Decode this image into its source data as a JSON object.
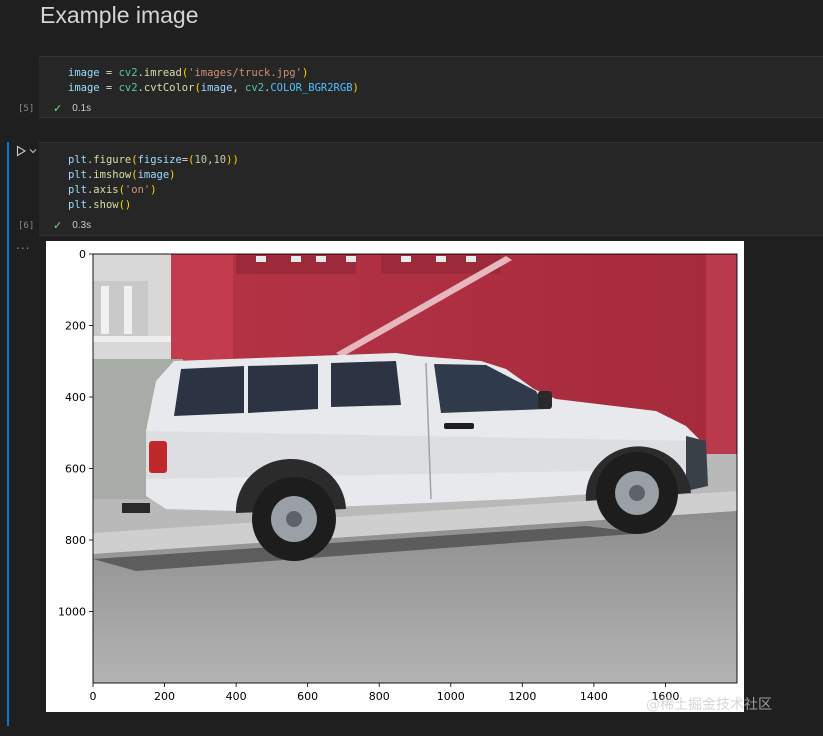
{
  "notebook": {
    "heading": "Example image",
    "cells": [
      {
        "exec_count": "[5]",
        "status_time": "0.1s",
        "lines": [
          [
            [
              "var",
              "image"
            ],
            [
              "plain",
              " = "
            ],
            [
              "mod",
              "cv2"
            ],
            [
              "plain",
              "."
            ],
            [
              "fn",
              "imread"
            ],
            [
              "paren",
              "("
            ],
            [
              "str",
              "'images/truck.jpg'"
            ],
            [
              "paren",
              ")"
            ]
          ],
          [
            [
              "var",
              "image"
            ],
            [
              "plain",
              " = "
            ],
            [
              "mod",
              "cv2"
            ],
            [
              "plain",
              "."
            ],
            [
              "fn",
              "cvtColor"
            ],
            [
              "paren",
              "("
            ],
            [
              "var",
              "image"
            ],
            [
              "plain",
              ", "
            ],
            [
              "mod",
              "cv2"
            ],
            [
              "plain",
              "."
            ],
            [
              "const",
              "COLOR_BGR2RGB"
            ],
            [
              "paren",
              ")"
            ]
          ]
        ]
      },
      {
        "exec_count": "[6]",
        "status_time": "0.3s",
        "lines": [
          [
            [
              "var",
              "plt"
            ],
            [
              "plain",
              "."
            ],
            [
              "fn",
              "figure"
            ],
            [
              "paren",
              "("
            ],
            [
              "var",
              "figsize"
            ],
            [
              "plain",
              "="
            ],
            [
              "paren",
              "("
            ],
            [
              "num",
              "10"
            ],
            [
              "plain",
              ","
            ],
            [
              "num",
              "10"
            ],
            [
              "paren",
              "))"
            ]
          ],
          [
            [
              "var",
              "plt"
            ],
            [
              "plain",
              "."
            ],
            [
              "fn",
              "imshow"
            ],
            [
              "paren",
              "("
            ],
            [
              "var",
              "image"
            ],
            [
              "paren",
              ")"
            ]
          ],
          [
            [
              "var",
              "plt"
            ],
            [
              "plain",
              "."
            ],
            [
              "fn",
              "axis"
            ],
            [
              "paren",
              "("
            ],
            [
              "str",
              "'on'"
            ],
            [
              "paren",
              ")"
            ]
          ],
          [
            [
              "var",
              "plt"
            ],
            [
              "plain",
              "."
            ],
            [
              "fn",
              "show"
            ],
            [
              "paren",
              "()"
            ]
          ]
        ]
      }
    ],
    "output_more": "...",
    "status_check": "✓"
  },
  "icons": {
    "run": "run-cell-icon",
    "chevron": "chevron-down-icon",
    "check": "check-icon",
    "more": "more-actions-icon"
  },
  "colors": {
    "background": "#1f1f1f",
    "cell_background": "#262626",
    "focus_accent": "#0078d4",
    "success": "#89d185"
  },
  "chart_data": {
    "type": "image",
    "title": "",
    "xlabel": "",
    "ylabel": "",
    "xlim": [
      0,
      1800
    ],
    "ylim": [
      1200,
      0
    ],
    "x_ticks": [
      0,
      200,
      400,
      600,
      800,
      1000,
      1200,
      1400,
      1600
    ],
    "y_ticks": [
      0,
      200,
      400,
      600,
      800,
      1000
    ],
    "image_subject": "white pickup truck parked in front of red wall"
  },
  "watermark": "@稀土掘金技术社区"
}
